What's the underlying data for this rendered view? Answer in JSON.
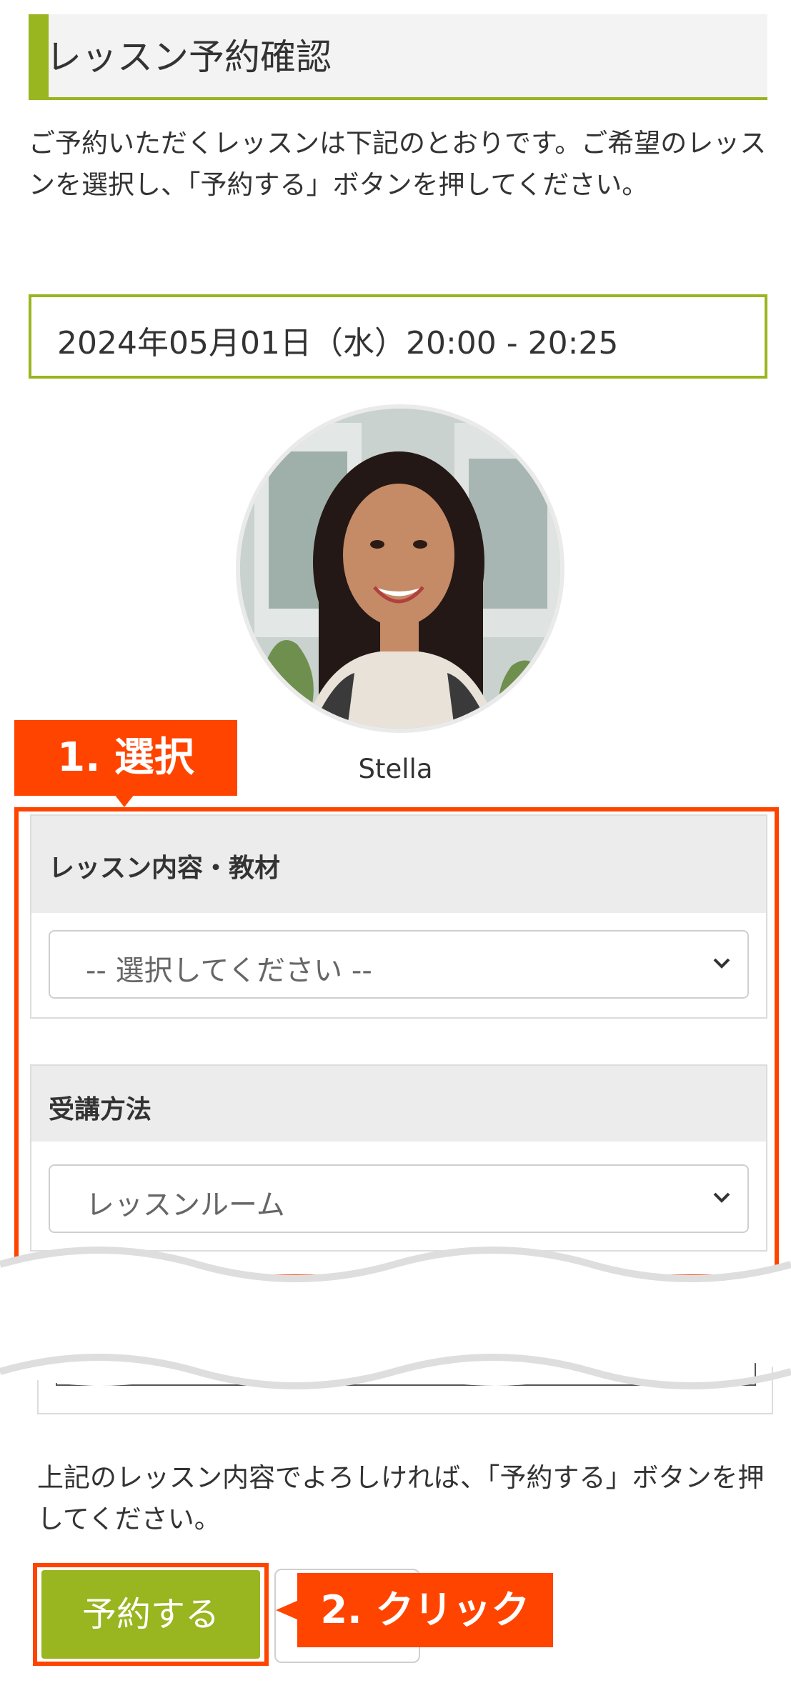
{
  "header": {
    "title": "レッスン予約確認"
  },
  "intro": {
    "text": "ご予約いただくレッスンは下記のとおりです。ご希望のレッスンを選択し、「予約する」ボタンを押してください。"
  },
  "lesson": {
    "datetime": "2024年05月01日（水）20:00 - 20:25"
  },
  "tutor": {
    "name": "Stella"
  },
  "annotations": {
    "step1": "1. 選択",
    "step2": "2. クリック"
  },
  "form": {
    "content": {
      "label": "レッスン内容・教材",
      "selected": "-- 選択してください --"
    },
    "method": {
      "label": "受講方法",
      "selected": "レッスンルーム"
    }
  },
  "footer": {
    "confirm_text": "上記のレッスン内容でよろしければ、「予約する」ボタンを押してください。",
    "reserve_button": "予約する"
  },
  "colors": {
    "accent": "#99b51f",
    "highlight": "#ff4400"
  }
}
